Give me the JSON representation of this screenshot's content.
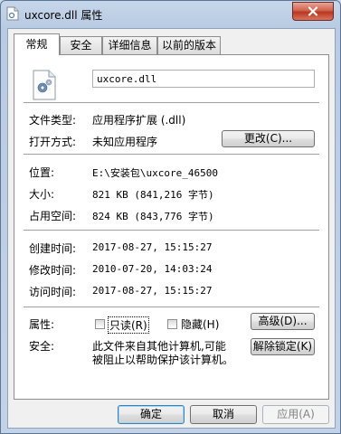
{
  "window": {
    "title": "uxcore.dll 属性"
  },
  "tabs": [
    {
      "label": "常规"
    },
    {
      "label": "安全"
    },
    {
      "label": "详细信息"
    },
    {
      "label": "以前的版本"
    }
  ],
  "general": {
    "file_name": "uxcore.dll",
    "type_label": "文件类型:",
    "type_value": "应用程序扩展 (.dll)",
    "opens_label": "打开方式:",
    "opens_value": "未知应用程序",
    "change_button": "更改(C)...",
    "location_label": "位置:",
    "location_value": "E:\\安装包\\uxcore_46500",
    "size_label": "大小:",
    "size_value": "821 KB (841,216 字节)",
    "size_on_disk_label": "占用空间:",
    "size_on_disk_value": "824 KB (843,776 字节)",
    "created_label": "创建时间:",
    "created_value": "2017-08-27, 15:15:27",
    "modified_label": "修改时间:",
    "modified_value": "2010-07-20, 14:03:24",
    "accessed_label": "访问时间:",
    "accessed_value": "2017-08-27, 15:15:27",
    "attributes_label": "属性:",
    "readonly_label": "只读(R)",
    "readonly_checked": false,
    "hidden_label": "隐藏(H)",
    "hidden_checked": false,
    "advanced_button": "高级(D)...",
    "security_label": "安全:",
    "security_text_line1": "此文件来自其他计算机,可能",
    "security_text_line2": "被阻止以帮助保护该计算机。",
    "unblock_button": "解除锁定(K)"
  },
  "footer": {
    "ok": "确定",
    "cancel": "取消",
    "apply": "应用(A)"
  }
}
